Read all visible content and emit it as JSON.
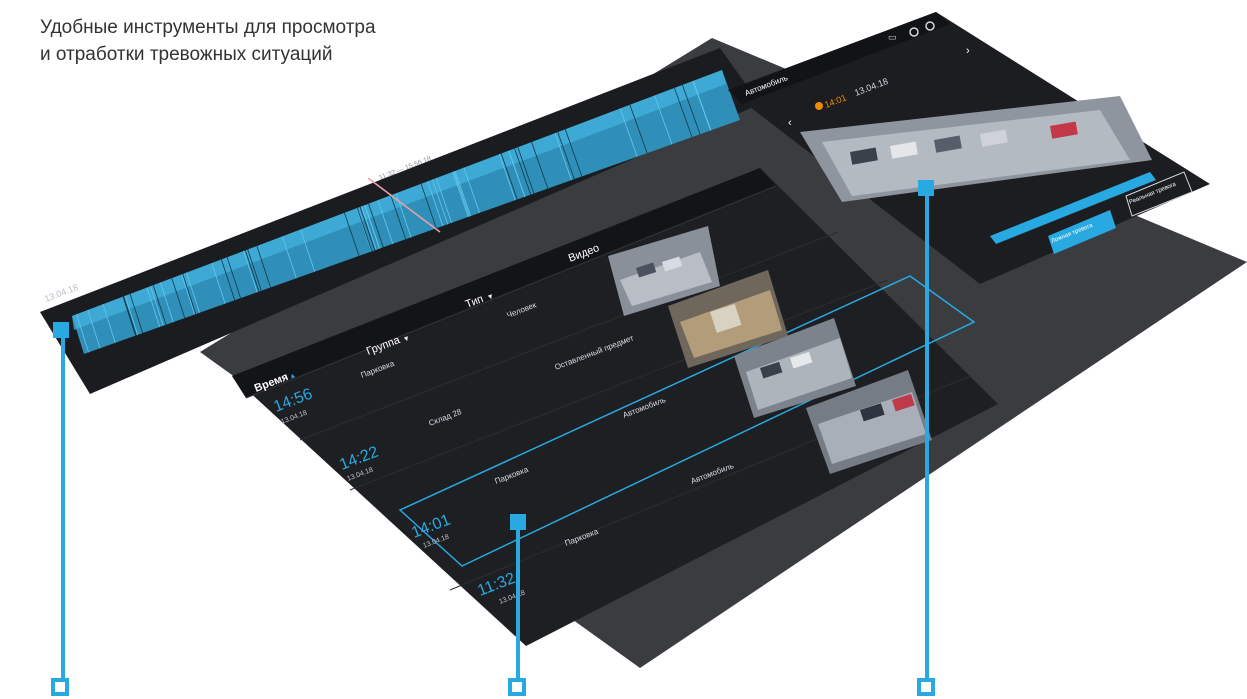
{
  "heading": {
    "line1": "Удобные инструменты для просмотра",
    "line2": "и отработки тревожных ситуаций"
  },
  "colors": {
    "accent": "#29a9e1",
    "panel": "#1e1f23",
    "panel_header": "#131417",
    "backplate": "#3a3c40",
    "alarm_badge": "#f08a00"
  },
  "timeline": {
    "date_label": "13.04.18",
    "range_label": "11:32 — 15:56 18"
  },
  "events_table": {
    "columns": {
      "time": "Время",
      "group": "Группа",
      "type": "Тип",
      "video": "Видео"
    },
    "rows": [
      {
        "time": "14:56",
        "date": "13.04.18",
        "group": "Парковка",
        "type": "Человек",
        "selected": false
      },
      {
        "time": "14:22",
        "date": "13.04.18",
        "group": "Склад 28",
        "type": "Оставленный предмет",
        "selected": false
      },
      {
        "time": "14:01",
        "date": "13.04.18",
        "group": "Парковка",
        "type": "Автомобиль",
        "selected": true
      },
      {
        "time": "11:32",
        "date": "13.04.18",
        "group": "Парковка",
        "type": "Автомобиль",
        "selected": false
      }
    ]
  },
  "alarm_panel": {
    "title": "Автомобиль",
    "time": "14:01",
    "date": "13.04.18",
    "reset_button": "Ложная тревога",
    "confirm_button": "Реальная тревога"
  }
}
